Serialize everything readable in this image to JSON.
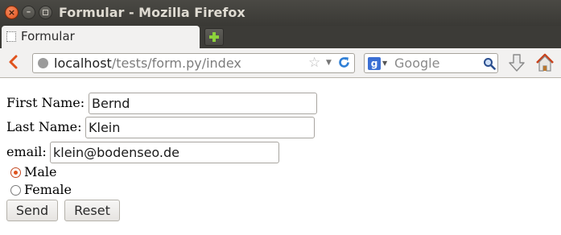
{
  "window": {
    "title": "Formular - Mozilla Firefox"
  },
  "tab": {
    "label": "Formular"
  },
  "urlbar": {
    "host": "localhost",
    "path": "/tests/form.py/index"
  },
  "searchbar": {
    "engine_letter": "g",
    "placeholder": "Google"
  },
  "form": {
    "first_name": {
      "label": "First Name:",
      "value": "Bernd"
    },
    "last_name": {
      "label": "Last Name:",
      "value": "Klein"
    },
    "email": {
      "label": "email:",
      "value": "klein@bodenseo.de"
    },
    "gender": [
      {
        "label": "Male",
        "checked": true
      },
      {
        "label": "Female",
        "checked": false
      }
    ],
    "send_label": "Send",
    "reset_label": "Reset"
  },
  "icons": {
    "close": "close-icon",
    "minimize": "minimize-icon",
    "maximize": "maximize-icon",
    "back": "back-arrow-icon",
    "globe": "globe-icon",
    "star": "bookmark-star-icon",
    "reload": "reload-icon",
    "search": "magnifier-icon",
    "download": "download-arrow-icon",
    "home": "home-icon"
  },
  "colors": {
    "titlebar": "#3c3b37",
    "accent_orange": "#e0531d",
    "newtab_plus": "#8cd13b"
  }
}
